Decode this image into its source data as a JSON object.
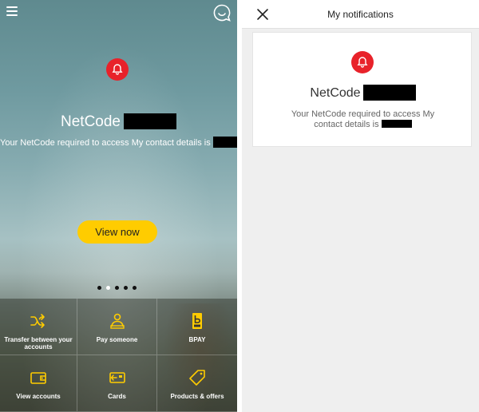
{
  "left_screen": {
    "notification": {
      "title": "NetCode",
      "message": "Your NetCode required to access My contact details is",
      "cta_label": "View now"
    },
    "carousel": {
      "total": 5,
      "active_index": 1
    },
    "tiles": [
      {
        "label": "Transfer between your accounts",
        "icon": "shuffle-icon"
      },
      {
        "label": "Pay someone",
        "icon": "person-pay-icon"
      },
      {
        "label": "BPAY",
        "icon": "bpay-icon"
      },
      {
        "label": "View accounts",
        "icon": "wallet-icon"
      },
      {
        "label": "Cards",
        "icon": "card-icon"
      },
      {
        "label": "Products & offers",
        "icon": "tag-icon"
      }
    ]
  },
  "right_screen": {
    "header_title": "My notifications",
    "card": {
      "title": "NetCode",
      "message": "Your NetCode required to access My contact details is"
    }
  },
  "colors": {
    "accent_yellow": "#ffcc00",
    "alert_red": "#e8222a",
    "tile_icon_yellow": "#ffcc00"
  }
}
